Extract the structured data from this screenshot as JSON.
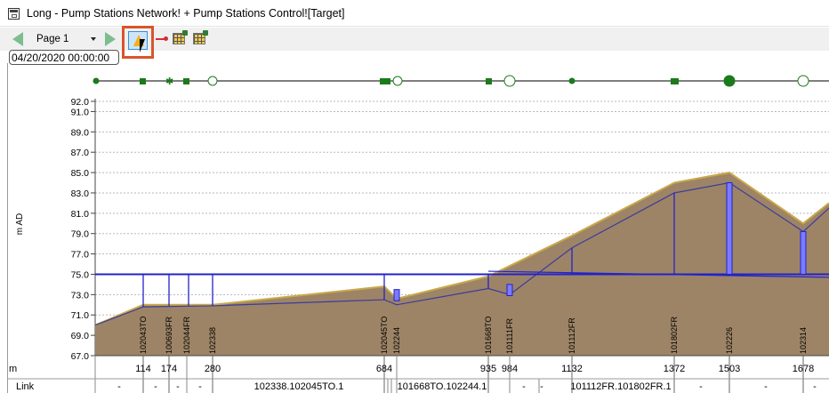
{
  "window": {
    "title": "Long - Pump Stations Network! + Pump Stations Control![Target]"
  },
  "toolbar": {
    "page": "Page 1"
  },
  "timestamp": "04/20/2020 00:00:00",
  "y_axis": {
    "label": "m AD",
    "ticks": [
      "92.0",
      "91.0",
      "89.0",
      "87.0",
      "85.0",
      "83.0",
      "81.0",
      "79.0",
      "77.0",
      "75.0",
      "73.0",
      "71.0",
      "69.0",
      "67.0"
    ]
  },
  "chart_data": {
    "type": "area",
    "xlabel": "m",
    "ylabel": "m AD",
    "ylim": [
      67.0,
      92.0
    ],
    "distance_labels": [
      "114",
      "174",
      "280",
      "684",
      "935",
      "984",
      "1132",
      "1372",
      "1503",
      "1678"
    ],
    "nodes": [
      "102043TO",
      "100693FR",
      "102044FR",
      "102338",
      "102045TO",
      "102244",
      "101668TO",
      "101111FR",
      "101112FR",
      "101802FR",
      "102226",
      "102314"
    ],
    "ground_level": [
      {
        "x": 0,
        "y": 70.0
      },
      {
        "x": 114,
        "y": 72.0
      },
      {
        "x": 280,
        "y": 72.0
      },
      {
        "x": 684,
        "y": 73.8
      },
      {
        "x": 700,
        "y": 72.6
      },
      {
        "x": 935,
        "y": 74.8
      },
      {
        "x": 1132,
        "y": 78.8
      },
      {
        "x": 1372,
        "y": 84.0
      },
      {
        "x": 1503,
        "y": 85.0
      },
      {
        "x": 1678,
        "y": 80.0
      },
      {
        "x": 1750,
        "y": 82.0
      }
    ],
    "hydraulic_grade": 75.0
  },
  "link_row": {
    "label": "Link",
    "cells": [
      "-",
      "-",
      "-",
      "-",
      "102338.102045TO.1",
      "101668TO.102244.1",
      "-",
      "-",
      "101112FR.101802FR.1",
      "-",
      "-",
      "-"
    ]
  }
}
